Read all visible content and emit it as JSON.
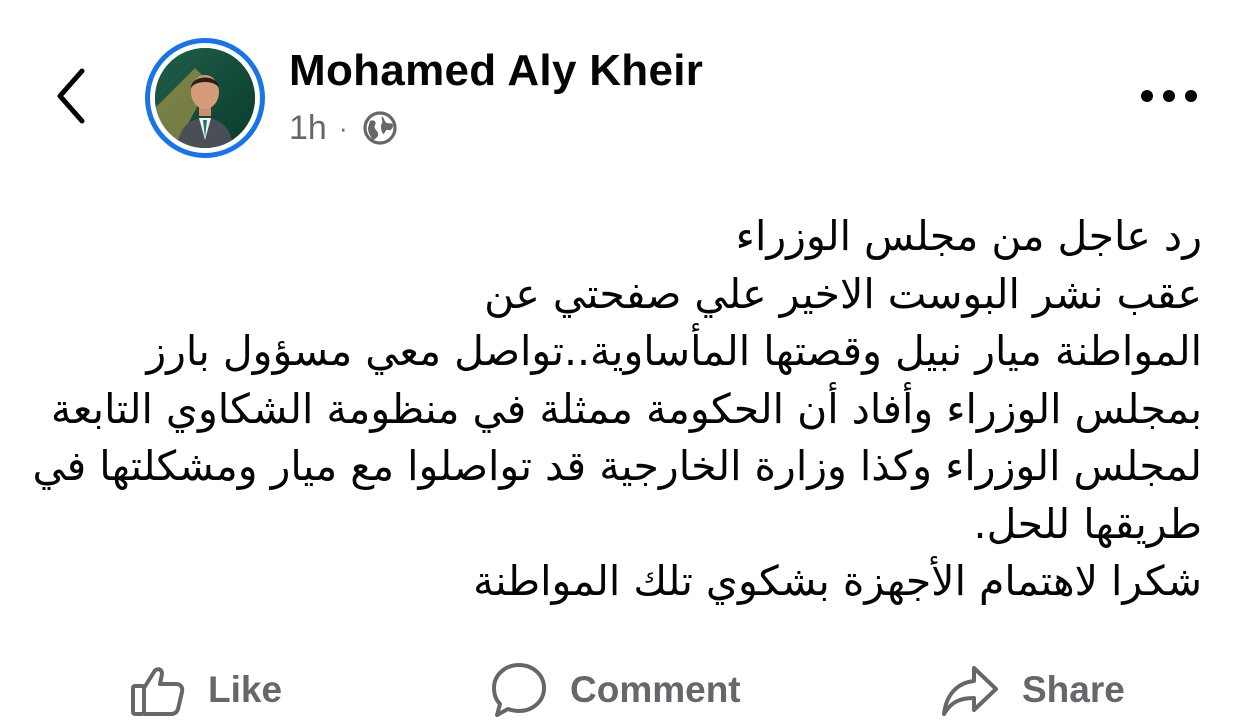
{
  "post": {
    "author_name": "Mohamed Aly Kheir",
    "timestamp": "1h",
    "separator": "·",
    "privacy_icon": "globe-icon",
    "text_lines": [
      "رد عاجل من مجلس الوزراء",
      "عقب نشر البوست الاخير علي صفحتي عن",
      " المواطنة ميار نبيل وقصتها المأساوية..تواصل معي مسؤول بارز",
      "بمجلس الوزراء وأفاد أن الحكومة ممثلة في منظومة الشكاوي التابعة",
      "لمجلس الوزراء وكذا وزارة الخارجية قد تواصلوا مع ميار ومشكلتها في",
      "طريقها للحل.",
      "شكرا لاهتمام الأجهزة بشكوي تلك المواطنة"
    ]
  },
  "actions": {
    "like": "Like",
    "comment": "Comment",
    "share": "Share"
  },
  "colors": {
    "accent": "#1b74e4",
    "secondary_text": "#65676b",
    "primary_text": "#050505"
  },
  "icons": {
    "back": "chevron-left-icon",
    "more": "more-horizontal-icon",
    "like": "thumbs-up-icon",
    "comment": "comment-bubble-icon",
    "share": "share-arrow-icon"
  }
}
